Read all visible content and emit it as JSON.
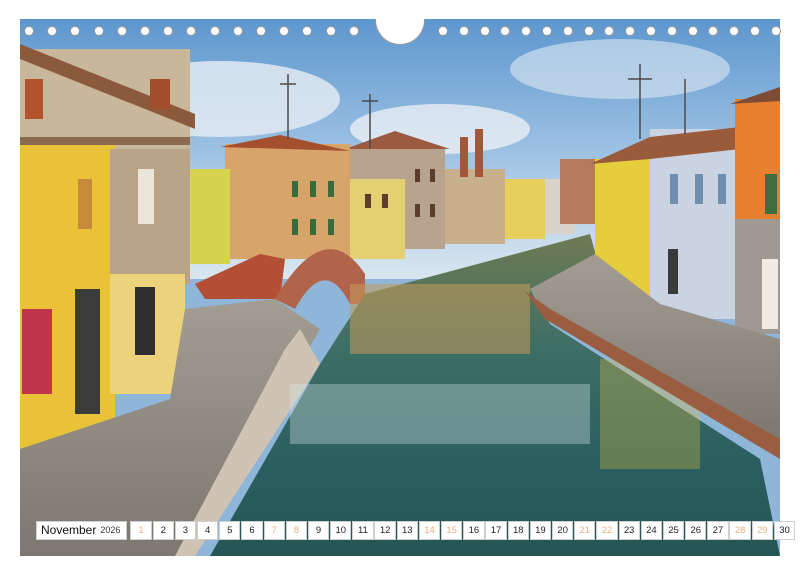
{
  "calendar": {
    "month": "November",
    "year": "2026",
    "weekend_color": "#e5b17e",
    "days": [
      {
        "n": "1",
        "we": true
      },
      {
        "n": "2",
        "we": false
      },
      {
        "n": "3",
        "we": false
      },
      {
        "n": "4",
        "we": false
      },
      {
        "n": "5",
        "we": false
      },
      {
        "n": "6",
        "we": false
      },
      {
        "n": "7",
        "we": true
      },
      {
        "n": "8",
        "we": true
      },
      {
        "n": "9",
        "we": false
      },
      {
        "n": "10",
        "we": false
      },
      {
        "n": "11",
        "we": false
      },
      {
        "n": "12",
        "we": false
      },
      {
        "n": "13",
        "we": false
      },
      {
        "n": "14",
        "we": true
      },
      {
        "n": "15",
        "we": true
      },
      {
        "n": "16",
        "we": false
      },
      {
        "n": "17",
        "we": false
      },
      {
        "n": "18",
        "we": false
      },
      {
        "n": "19",
        "we": false
      },
      {
        "n": "20",
        "we": false
      },
      {
        "n": "21",
        "we": true
      },
      {
        "n": "22",
        "we": true
      },
      {
        "n": "23",
        "we": false
      },
      {
        "n": "24",
        "we": false
      },
      {
        "n": "25",
        "we": false
      },
      {
        "n": "26",
        "we": false
      },
      {
        "n": "27",
        "we": false
      },
      {
        "n": "28",
        "we": true
      },
      {
        "n": "29",
        "we": true
      },
      {
        "n": "30",
        "we": false
      }
    ]
  },
  "photo": {
    "subject": "canal-town-street",
    "colors": {
      "sky": "#7fb0dc",
      "water": "#2f6b6a",
      "yellow_house": "#e8c23a",
      "orange_house": "#e27a2e",
      "pavement": "#8e8a86"
    }
  },
  "binding": {
    "hole_count": 32
  }
}
